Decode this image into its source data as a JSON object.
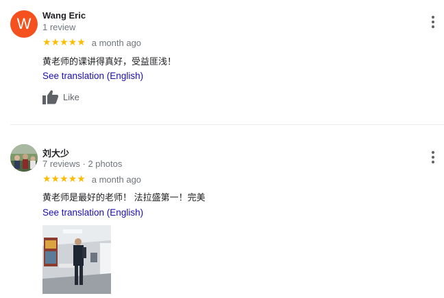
{
  "reviews": [
    {
      "avatar_letter": "W",
      "avatar_color": "#f4511e",
      "name": "Wang Eric",
      "meta": "1 review",
      "rating": 5,
      "stars": "★★★★★",
      "date": "a month ago",
      "text": "黄老师的课讲得真好，受益匪浅！",
      "translate_link": "See translation (English)",
      "like_label": "Like"
    },
    {
      "name": "刘大少",
      "meta": "7 reviews · 2 photos",
      "rating": 5,
      "stars": "★★★★★",
      "date": "a month ago",
      "text": "黄老师是最好的老师！ 法拉盛第一！完美",
      "translate_link": "See translation (English)"
    }
  ],
  "icons": {
    "more": "more-vert-icon",
    "like": "thumbs-up-icon",
    "star": "star-icon"
  },
  "colors": {
    "star": "#fbbc04",
    "link": "#1a0dab",
    "secondary_text": "#70757a"
  }
}
